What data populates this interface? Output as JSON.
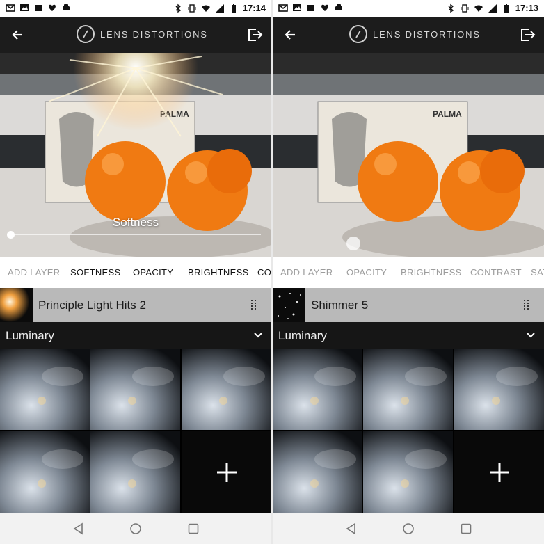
{
  "colors": {
    "status_bar_bg": "#ffffff",
    "app_bar_bg": "#1c1c1c",
    "tabs_bg": "#ffffff",
    "layer_row_bg": "#b9b9b9",
    "dropdown_bg": "#161616",
    "nav_bar_bg": "#f2f2f2",
    "orange": "#f07a12"
  },
  "screens": [
    {
      "status_bar": {
        "time": "17:14",
        "left_icons": [
          "gmail-icon",
          "image-icon",
          "shopping-icon",
          "heart-icon",
          "car-icon"
        ],
        "right_icons": [
          "bluetooth-icon",
          "vibrate-icon",
          "wifi-icon",
          "signal-icon",
          "battery-icon"
        ]
      },
      "app_bar": {
        "title": "LENS DISTORTIONS"
      },
      "photo": {
        "overlay_label": "Softness",
        "effect": "sun-flare",
        "slider_value": 0
      },
      "tabs": [
        {
          "label": "ADD LAYER",
          "active": false
        },
        {
          "label": "SOFTNESS",
          "active": true
        },
        {
          "label": "OPACITY",
          "active": true
        },
        {
          "label": "BRIGHTNESS",
          "active": true
        },
        {
          "label": "COI",
          "active": true
        }
      ],
      "layer": {
        "name": "Principle Light Hits 2"
      },
      "category": {
        "label": "Luminary"
      }
    },
    {
      "status_bar": {
        "time": "17:13",
        "left_icons": [
          "gmail-icon",
          "image-icon",
          "shopping-icon",
          "heart-icon",
          "car-icon"
        ],
        "right_icons": [
          "bluetooth-icon",
          "vibrate-icon",
          "wifi-icon",
          "signal-icon",
          "battery-icon"
        ]
      },
      "app_bar": {
        "title": "LENS DISTORTIONS"
      },
      "photo": {
        "overlay_label": "",
        "effect": "shimmer",
        "slider_value": 0.3
      },
      "tabs": [
        {
          "label": "ADD LAYER",
          "active": false
        },
        {
          "label": "OPACITY",
          "active": false
        },
        {
          "label": "BRIGHTNESS",
          "active": false
        },
        {
          "label": "CONTRAST",
          "active": false
        },
        {
          "label": "SAT",
          "active": false
        }
      ],
      "layer": {
        "name": "Shimmer 5"
      },
      "category": {
        "label": "Luminary"
      }
    }
  ]
}
